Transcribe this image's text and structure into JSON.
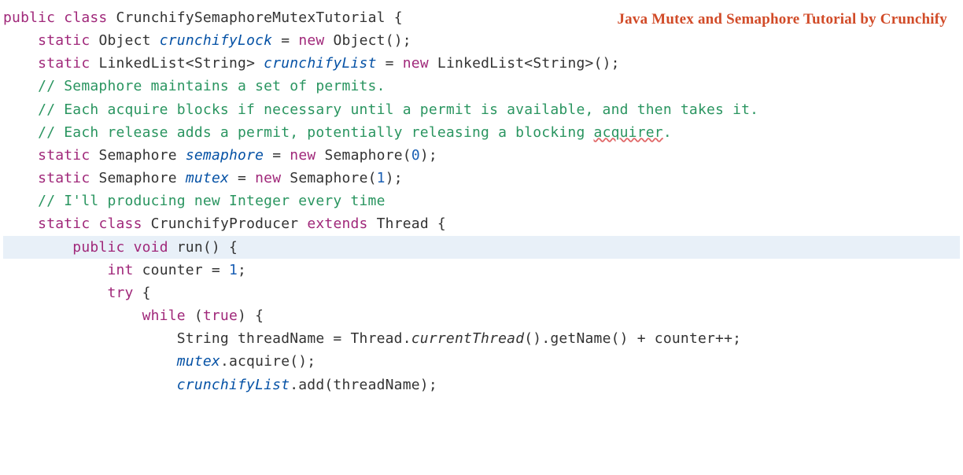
{
  "watermark": "Java Mutex and Semaphore Tutorial by Crunchify",
  "code": {
    "l1_public": "public",
    "l1_class": "class",
    "l1_name": "CrunchifySemaphoreMutexTutorial",
    "l1_brace": " {",
    "l2_static": "static",
    "l2_type": "Object",
    "l2_var": "crunchifyLock",
    "l2_eq": " = ",
    "l2_new": "new",
    "l2_ctor": " Object();",
    "l3_static": "static",
    "l3_type": "LinkedList<String>",
    "l3_var": "crunchifyList",
    "l3_eq": " = ",
    "l3_new": "new",
    "l3_ctor": " LinkedList<String>();",
    "l4": "",
    "l5_comment": "// Semaphore maintains a set of permits.",
    "l6_comment": "// Each acquire blocks if necessary until a permit is available, and then takes it.",
    "l7_comment_a": "// Each release adds a permit, potentially releasing a blocking ",
    "l7_comment_b": "acquirer",
    "l7_comment_c": ".",
    "l8_static": "static",
    "l8_type": "Semaphore",
    "l8_var": "semaphore",
    "l8_eq": " = ",
    "l8_new": "new",
    "l8_ctor_a": " Semaphore(",
    "l8_num": "0",
    "l8_ctor_b": ");",
    "l9_static": "static",
    "l9_type": "Semaphore",
    "l9_var": "mutex",
    "l9_eq": " = ",
    "l9_new": "new",
    "l9_ctor_a": " Semaphore(",
    "l9_num": "1",
    "l9_ctor_b": ");",
    "l10": "",
    "l11_comment": "// I'll producing new Integer every time",
    "l12_static": "static",
    "l12_class": "class",
    "l12_name": " CrunchifyProducer ",
    "l12_extends": "extends",
    "l12_super": " Thread {",
    "l13_public": "public",
    "l13_void": "void",
    "l13_run": " run() {",
    "l14_int": "int",
    "l14_rest": " counter = ",
    "l14_num": "1",
    "l14_semi": ";",
    "l15_try": "try",
    "l15_brace": " {",
    "l16_while": "while",
    "l16_open": " (",
    "l16_true": "true",
    "l16_close": ") {",
    "l17_type": "String",
    "l17_var": " threadName = Thread.",
    "l17_method": "currentThread",
    "l17_rest": "().getName() + counter++;",
    "l18": "",
    "l19_var": "mutex",
    "l19_rest": ".acquire();",
    "l20_var": "crunchifyList",
    "l20_rest": ".add(threadName);"
  }
}
